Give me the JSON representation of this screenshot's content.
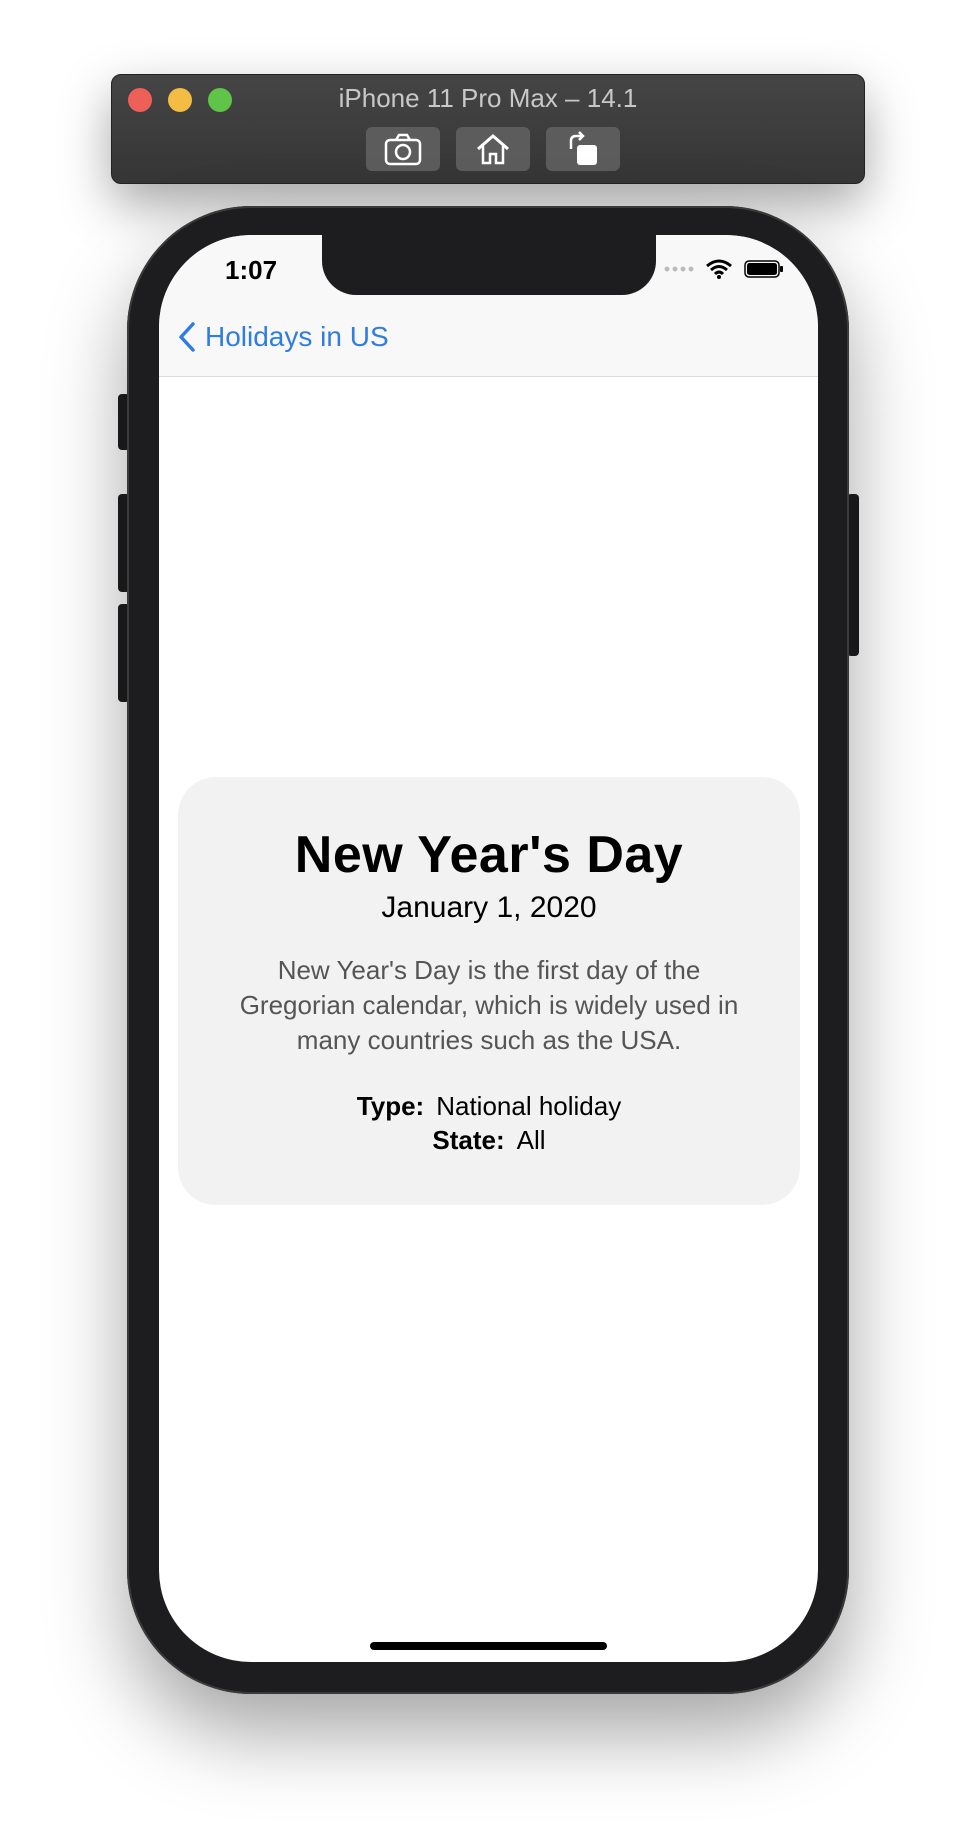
{
  "simulator": {
    "title": "iPhone 11 Pro Max – 14.1",
    "buttons": [
      "screenshot-icon",
      "home-icon",
      "rotate-icon"
    ]
  },
  "status_bar": {
    "time": "1:07"
  },
  "nav": {
    "back_label": "Holidays in US"
  },
  "holiday": {
    "name": "New Year's Day",
    "date": "January 1, 2020",
    "description": "New Year's Day is the first day of the Gregorian calendar, which is widely used in many countries such as the USA.",
    "type_label": "Type:",
    "type_value": "National holiday",
    "state_label": "State:",
    "state_value": "All"
  },
  "colors": {
    "accent": "#2f7de1",
    "card_background": "#f2f2f2"
  }
}
